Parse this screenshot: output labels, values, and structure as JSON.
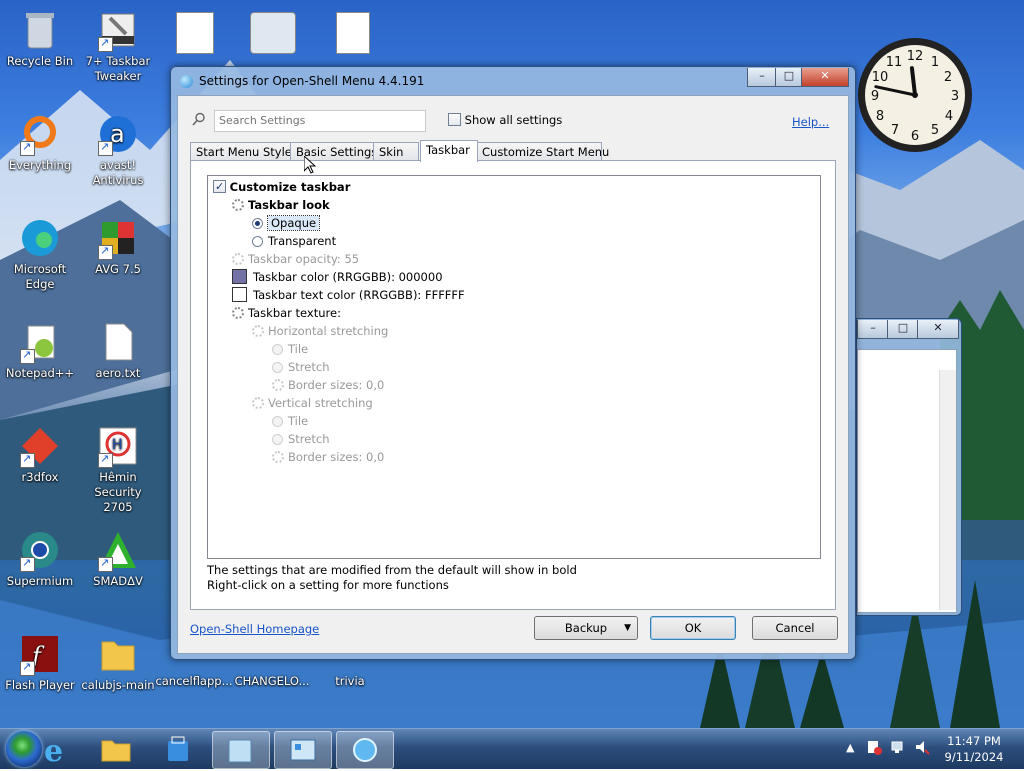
{
  "desktop": {
    "icons": [
      {
        "label": "Recycle Bin"
      },
      {
        "label": "7+ Taskbar Tweaker"
      },
      {
        "label": "Everything"
      },
      {
        "label": "avast! Antivirus"
      },
      {
        "label": "Microsoft Edge"
      },
      {
        "label": "AVG 7.5"
      },
      {
        "label": "Notepad++"
      },
      {
        "label": "aero.txt"
      },
      {
        "label": "r3dfox"
      },
      {
        "label": "Hêmin Security 2705"
      },
      {
        "label": "Supermium"
      },
      {
        "label": "SMADΔV"
      },
      {
        "label": "Flash Player"
      },
      {
        "label": "calubjs-main"
      },
      {
        "label": "cancelflapp..."
      },
      {
        "label": "CHANGELO..."
      },
      {
        "label": "trivia"
      }
    ],
    "clock": {
      "hour": 11,
      "minute": 47
    }
  },
  "window": {
    "title": "Settings for Open-Shell Menu 4.4.191",
    "search_placeholder": "Search Settings",
    "show_all_label": "Show all settings",
    "help_label": "Help...",
    "tabs": [
      {
        "label": "Start Menu Style"
      },
      {
        "label": "Basic Settings"
      },
      {
        "label": "Skin"
      },
      {
        "label": "Taskbar"
      },
      {
        "label": "Customize Start Menu"
      }
    ],
    "active_tab": "Taskbar",
    "tree": [
      {
        "label": "Customize taskbar"
      },
      {
        "label": "Taskbar look"
      },
      {
        "label": "Opaque"
      },
      {
        "label": "Transparent"
      },
      {
        "label": "Taskbar opacity: 55"
      },
      {
        "label": "Taskbar color (RRGGBB): 000000"
      },
      {
        "label": "Taskbar text color (RRGGBB): FFFFFF"
      },
      {
        "label": "Taskbar texture:"
      },
      {
        "label": "Horizontal stretching"
      },
      {
        "label": "Tile"
      },
      {
        "label": "Stretch"
      },
      {
        "label": "Border sizes: 0,0"
      },
      {
        "label": "Vertical stretching"
      },
      {
        "label": "Tile"
      },
      {
        "label": "Stretch"
      },
      {
        "label": "Border sizes: 0,0"
      }
    ],
    "swatches": {
      "taskbar_color": "#7272a6",
      "text_color": "#ffffff"
    },
    "note_line1": "The settings that are modified from the default will show in bold",
    "note_line2": "Right-click on a setting for more functions",
    "homepage_link": "Open-Shell Homepage",
    "buttons": {
      "backup": "Backup",
      "ok": "OK",
      "cancel": "Cancel"
    }
  },
  "taskbar": {
    "time": "11:47 PM",
    "date": "9/11/2024"
  }
}
